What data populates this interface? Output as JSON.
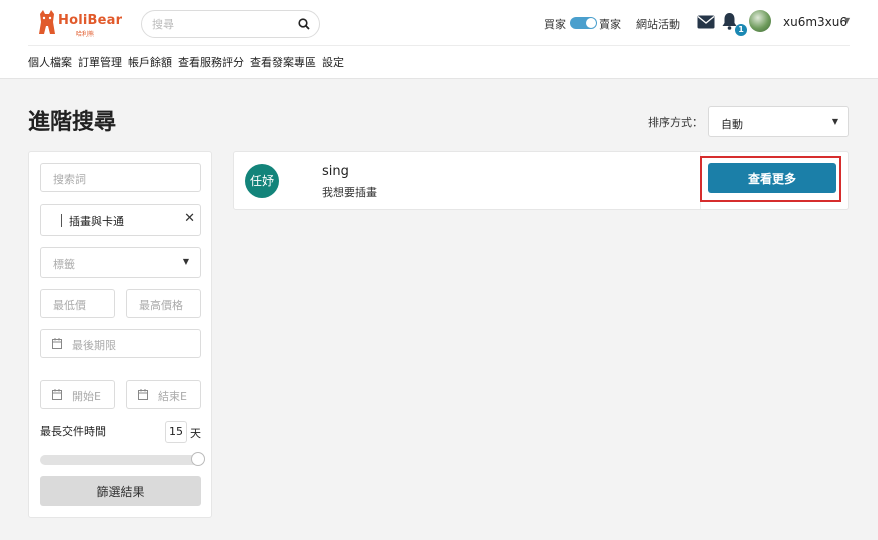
{
  "header": {
    "logo_text": "HoliBear",
    "logo_subtext": "哈利熊",
    "search_placeholder": "搜尋",
    "buyer_label": "買家",
    "seller_label": "賣家",
    "activity_label": "網站活動",
    "notification_count": "1",
    "username": "xu6m3xu6",
    "accent_color": "#1b7fa8"
  },
  "nav": {
    "items": [
      "個人檔案",
      "訂單管理",
      "帳戶餘額",
      "查看服務評分",
      "查看發案專區",
      "設定"
    ]
  },
  "page": {
    "title": "進階搜尋",
    "sort_label": "排序方式：",
    "sort_value": "自動"
  },
  "filter": {
    "keyword_placeholder": "搜索詞",
    "category_value": "插畫與卡通",
    "tag_placeholder": "標籤",
    "min_price_placeholder": "最低價",
    "max_price_placeholder": "最高價格",
    "deadline_placeholder": "最後期限",
    "start_placeholder": "開始E",
    "end_placeholder": "結束E",
    "delivery_label": "最長交件時間",
    "delivery_days": "15",
    "delivery_unit": "天",
    "submit_label": "篩選結果"
  },
  "results": [
    {
      "avatar_text": "任妤",
      "title": "sing",
      "description": "我想要插畫",
      "button_label": "查看更多"
    }
  ]
}
